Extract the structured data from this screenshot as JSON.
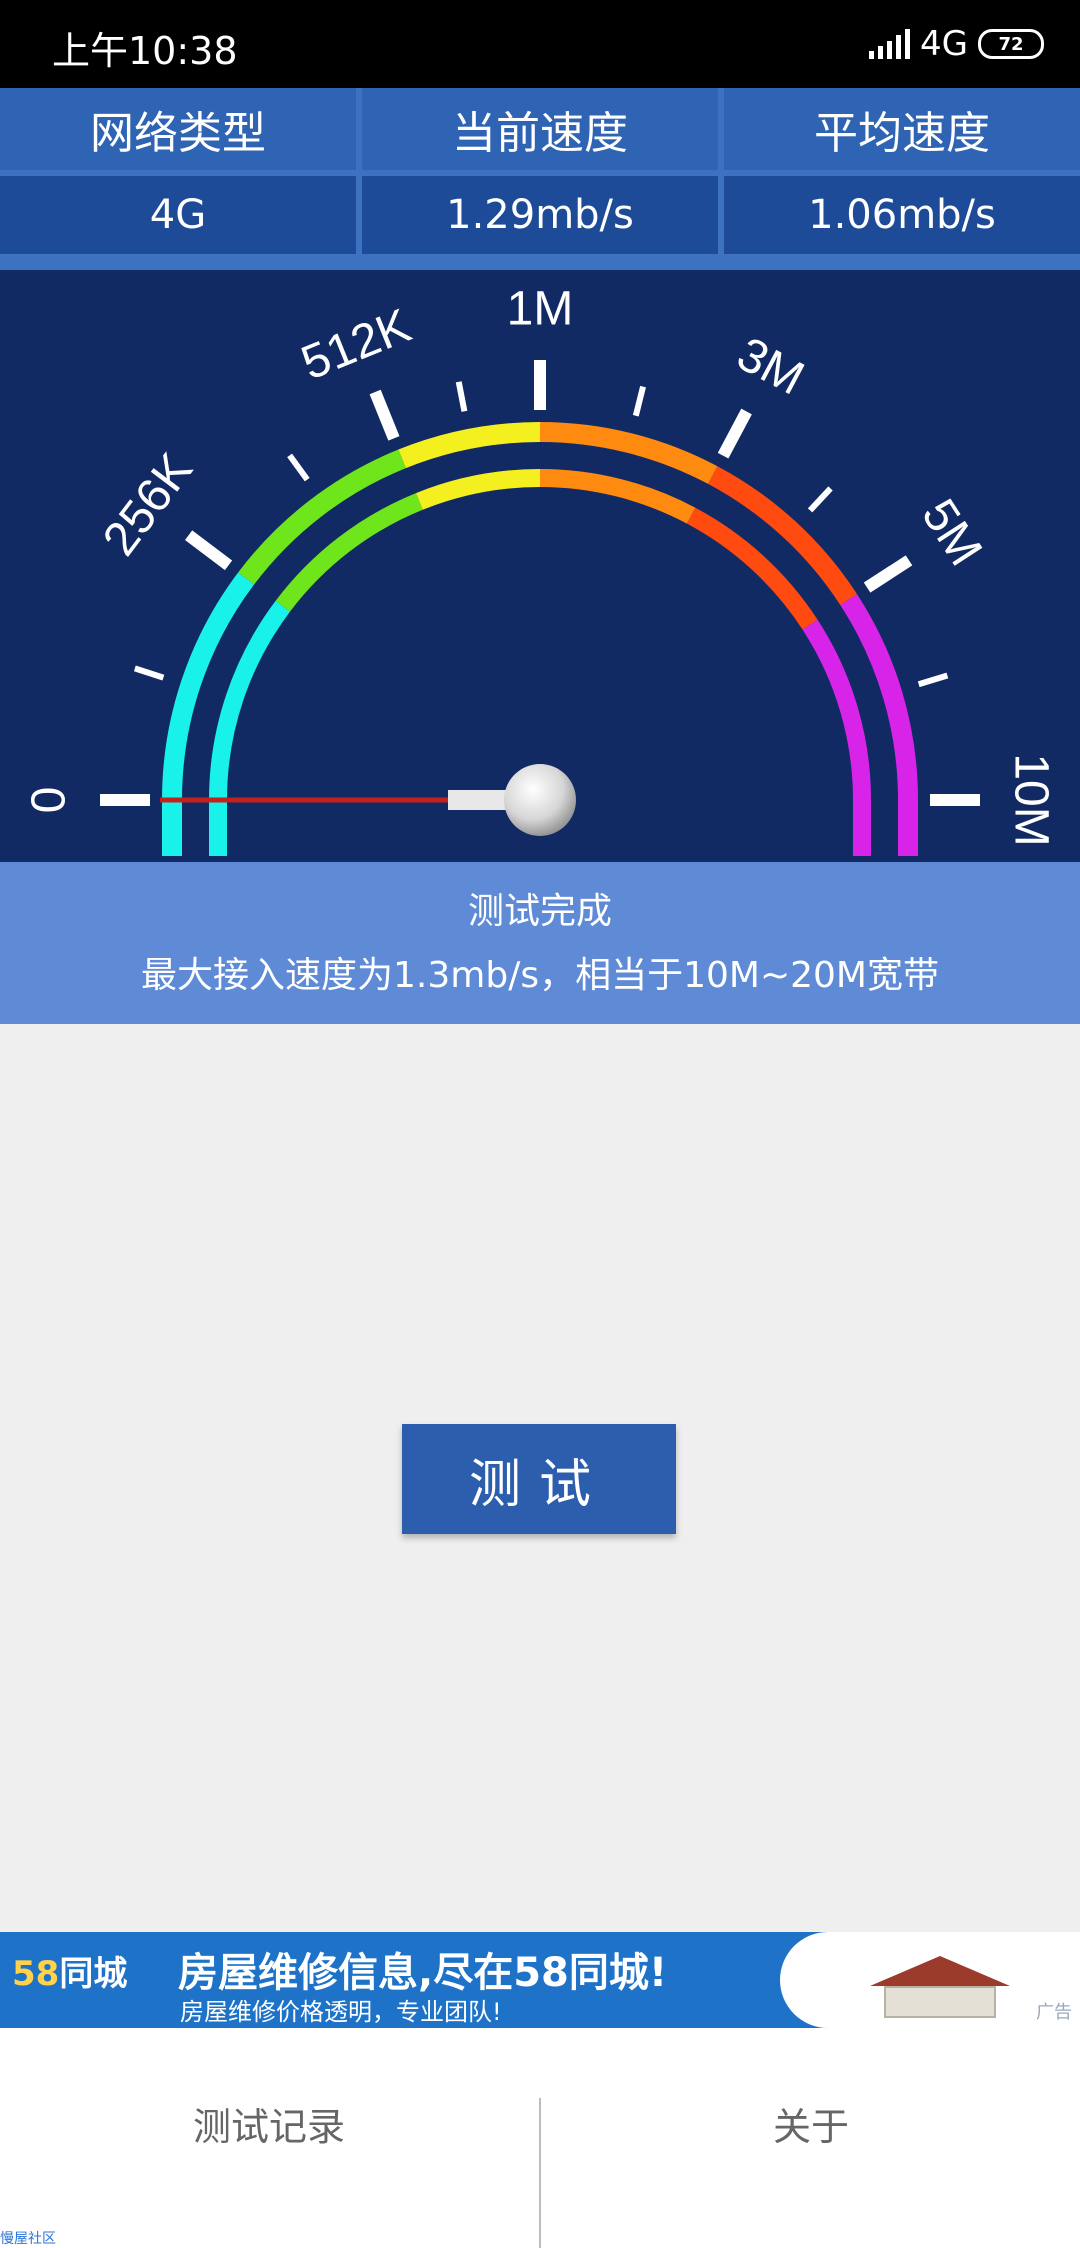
{
  "status_bar": {
    "time": "上午10:38",
    "network": "4G",
    "battery": "72"
  },
  "info_table": {
    "headers": [
      "网络类型",
      "当前速度",
      "平均速度"
    ],
    "values": [
      "4G",
      "1.29mb/s",
      "1.06mb/s"
    ]
  },
  "gauge": {
    "labels": [
      "0",
      "256K",
      "512K",
      "1M",
      "3M",
      "5M",
      "10M"
    ],
    "needle_value_fraction": 0.0,
    "colors": [
      "#19f2ea",
      "#6fe61b",
      "#f4ef1e",
      "#ff8a10",
      "#ff4a10",
      "#d724e8"
    ]
  },
  "result_panel": {
    "title": "测试完成",
    "message": "最大接入速度为1.3mb/s，相当于10M~20M宽带"
  },
  "test_button": {
    "label": "测试"
  },
  "ad_banner": {
    "logo_num": "58",
    "logo_text": "同城",
    "headline": "房屋维修信息,尽在58同城!",
    "subline": "房屋维修价格透明，专业团队!",
    "tag": "广告"
  },
  "bottom_nav": {
    "tabs": [
      "测试记录",
      "关于"
    ],
    "corner_text": "慢屋社区"
  }
}
